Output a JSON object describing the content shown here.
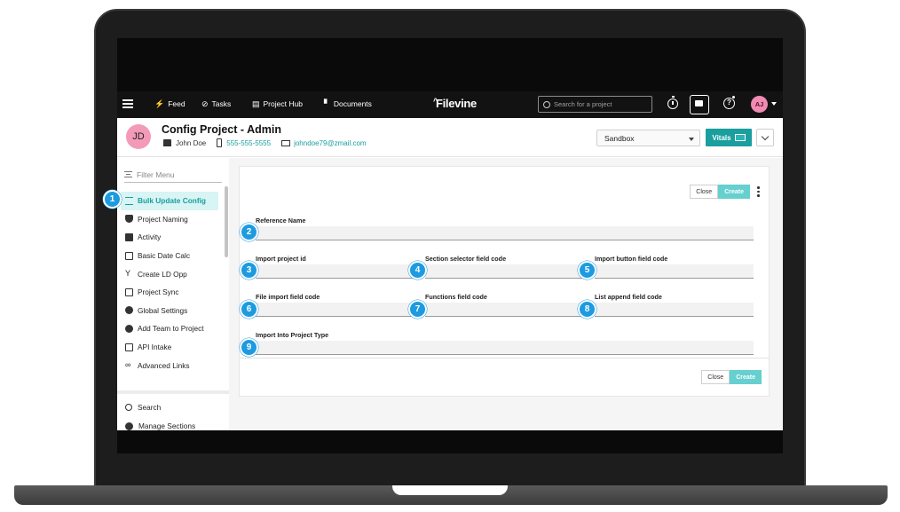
{
  "nav": {
    "items": [
      {
        "label": "Feed",
        "icon": "bolt-icon"
      },
      {
        "label": "Tasks",
        "icon": "check-circle-icon"
      },
      {
        "label": "Project Hub",
        "icon": "hub-icon"
      },
      {
        "label": "Documents",
        "icon": "document-icon"
      }
    ],
    "logo": "Filevine",
    "search_placeholder": "Search for a project",
    "user_initials": "AJ"
  },
  "project": {
    "initials": "JD",
    "title": "Config Project - Admin",
    "client": "John Doe",
    "phone": "555-555-5555",
    "email": "johndoe79@zmail.com",
    "environment": "Sandbox",
    "vitals_label": "Vitals"
  },
  "sidebar": {
    "filter_placeholder": "Filter Menu",
    "items": [
      {
        "label": "Bulk Update Config",
        "active": true
      },
      {
        "label": "Project Naming"
      },
      {
        "label": "Activity"
      },
      {
        "label": "Basic Date Calc"
      },
      {
        "label": "Create LD Opp"
      },
      {
        "label": "Project Sync"
      },
      {
        "label": "Global Settings"
      },
      {
        "label": "Add Team to Project"
      },
      {
        "label": "API Intake"
      },
      {
        "label": "Advanced Links"
      }
    ],
    "bottom": {
      "search": "Search",
      "manage_sections": "Manage Sections"
    }
  },
  "form": {
    "close_label": "Close",
    "create_label": "Create",
    "fields": {
      "reference_name": "Reference Name",
      "import_project_id": "Import project id",
      "section_selector": "Section selector field code",
      "import_button": "Import button field code",
      "file_import": "File import field code",
      "functions": "Functions field code",
      "list_append": "List append field code",
      "import_into_type": "Import Into Project Type"
    }
  },
  "markers": [
    "1",
    "2",
    "3",
    "4",
    "5",
    "6",
    "7",
    "8",
    "9"
  ],
  "colors": {
    "accent": "#1a9e9e",
    "create_button": "#66cfcf",
    "marker": "#1e9be0",
    "nav_bg": "#121212",
    "avatar": "#f49ab9"
  }
}
